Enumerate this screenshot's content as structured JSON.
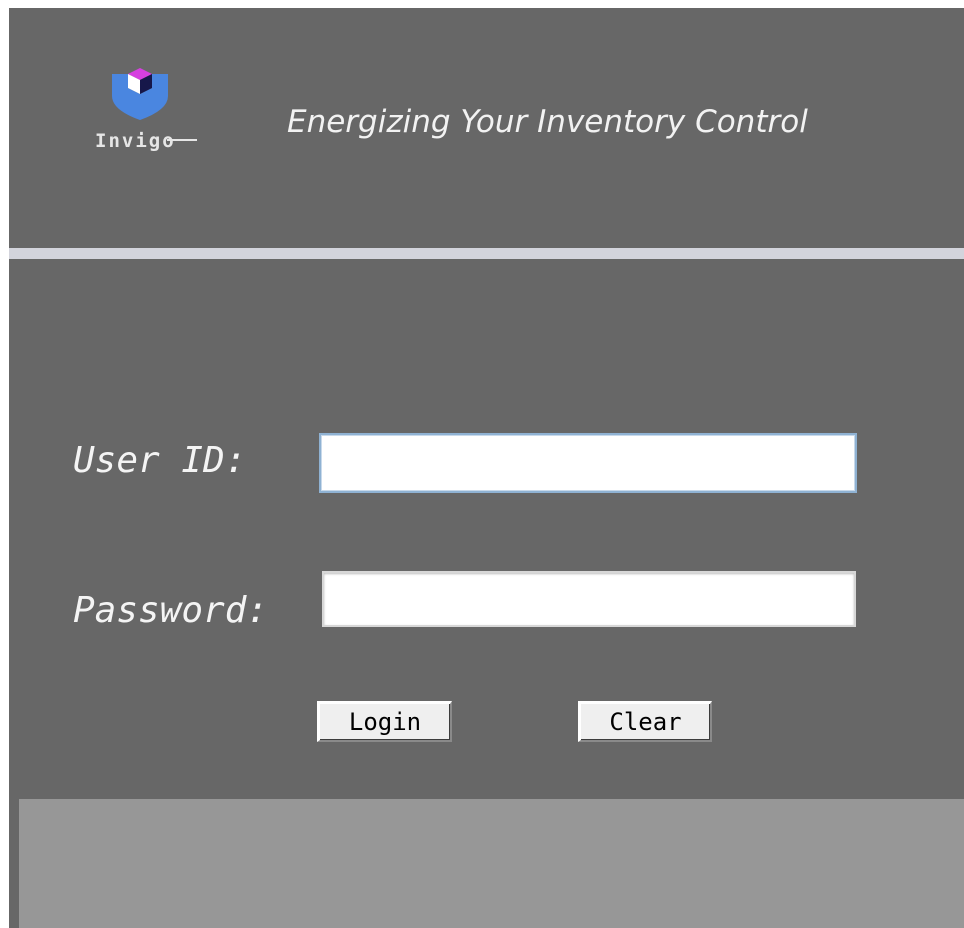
{
  "header": {
    "logo_text": "Invigo",
    "tagline": "Energizing Your Inventory Control"
  },
  "login_form": {
    "user_id_label": "User ID:",
    "user_id_value": "",
    "password_label": "Password:",
    "password_value": "",
    "login_button_label": "Login",
    "clear_button_label": "Clear"
  },
  "icons": {
    "logo": "cube-logo-icon"
  },
  "colors": {
    "background": "#676767",
    "divider": "#d3d4dc",
    "footer_panel": "#979797",
    "logo_blue": "#4a86e0",
    "logo_magenta": "#d63fe0",
    "logo_navy": "#16174a",
    "text": "#f2f2f2"
  }
}
